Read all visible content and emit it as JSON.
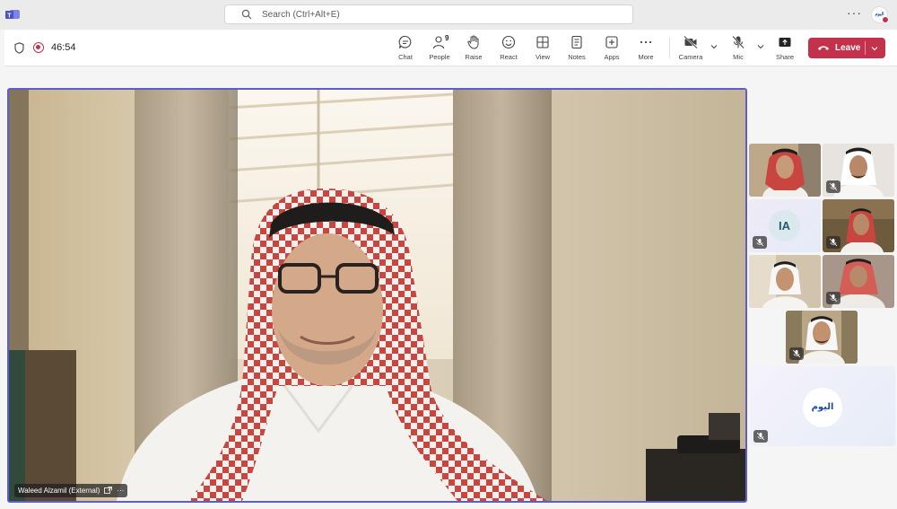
{
  "search": {
    "placeholder": "Search (Ctrl+Alt+E)"
  },
  "org_avatar": {
    "text": "اليوم"
  },
  "meeting": {
    "timer": "46:54"
  },
  "toolbar": {
    "chat": "Chat",
    "people": "People",
    "people_count": "9",
    "raise": "Raise",
    "react": "React",
    "view": "View",
    "notes": "Notes",
    "apps": "Apps",
    "more": "More",
    "camera": "Camera",
    "mic": "Mic",
    "share": "Share",
    "leave": "Leave"
  },
  "main_speaker": {
    "name": "Waleed Alzamil (External)"
  },
  "gallery": {
    "ia_initials": "IA",
    "logo_text": "اليوم"
  },
  "colors": {
    "accent": "#5b5fc7",
    "leave": "#c4314b",
    "recording": "#c4314b"
  }
}
